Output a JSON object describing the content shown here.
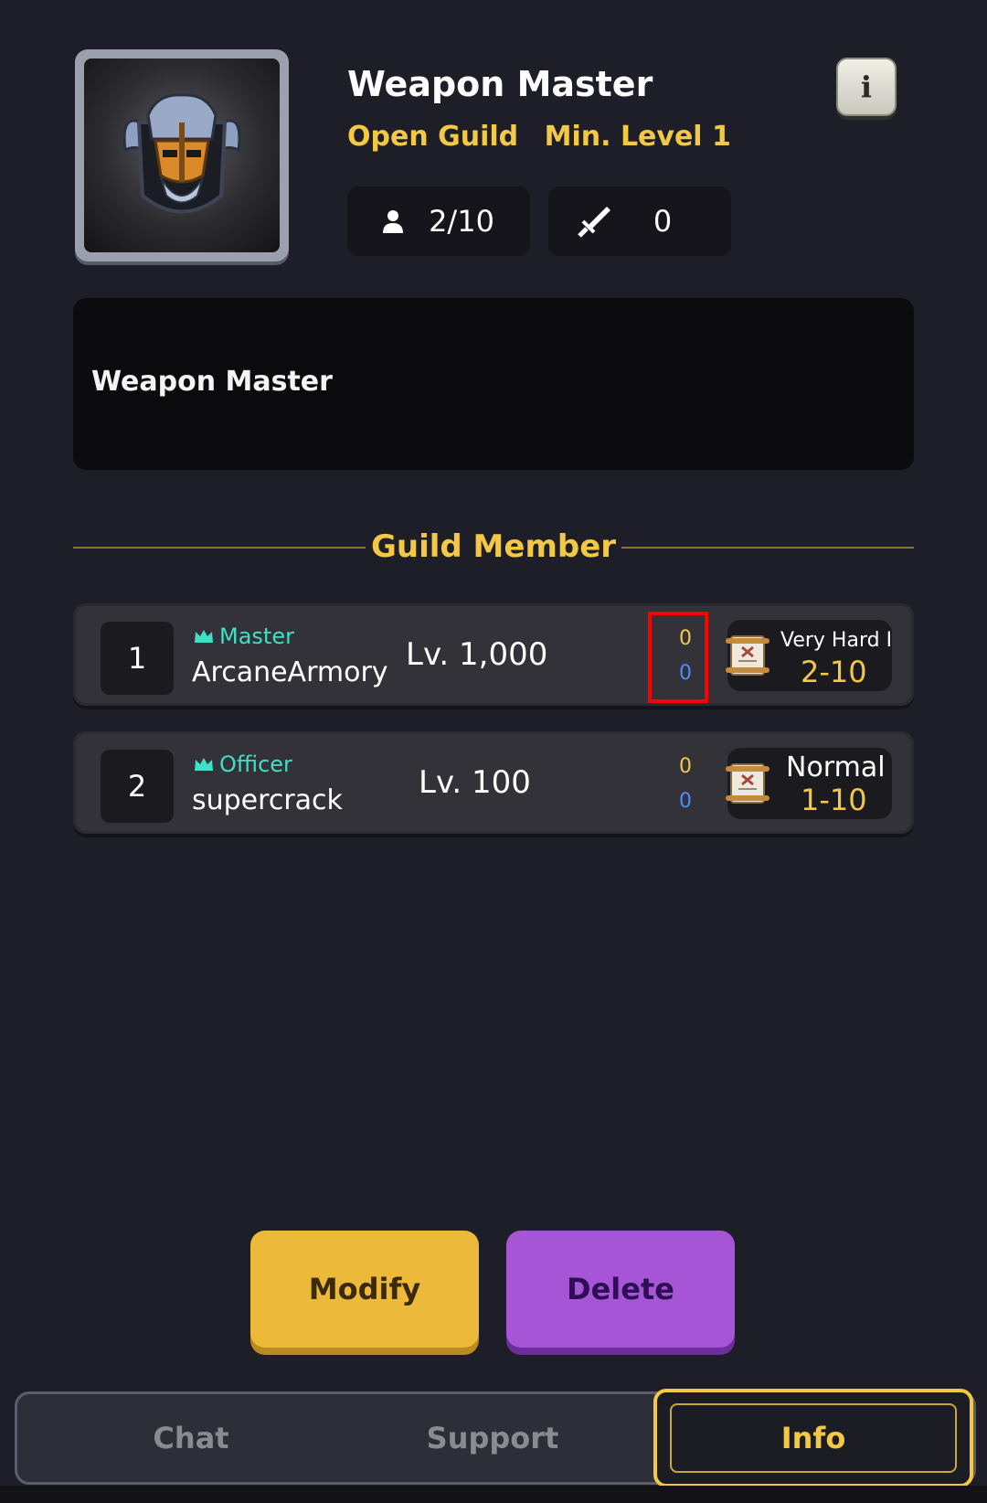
{
  "guild": {
    "name": "Weapon Master",
    "type": "Open Guild",
    "min_level": "Min. Level 1",
    "members_count": "2/10",
    "power": "0",
    "description": "Weapon Master",
    "info_label": "i"
  },
  "section_title": "Guild Member",
  "members": [
    {
      "rank": "1",
      "role": "Master",
      "name": "ArcaneArmory",
      "level": "Lv. 1,000",
      "score_top": "0",
      "score_bottom": "0",
      "difficulty": "Very Hard I",
      "stage": "2-10"
    },
    {
      "rank": "2",
      "role": "Officer",
      "name": "supercrack",
      "level": "Lv. 100",
      "score_top": "0",
      "score_bottom": "0",
      "difficulty": "Normal",
      "stage": "1-10"
    }
  ],
  "buttons": {
    "modify": "Modify",
    "delete": "Delete"
  },
  "tabs": [
    {
      "label": "Chat",
      "active": false
    },
    {
      "label": "Support",
      "active": false
    },
    {
      "label": "Info",
      "active": true
    }
  ],
  "colors": {
    "background": "#1e1e28",
    "accent_gold": "#f2c844",
    "role_teal": "#3fe0c6",
    "score_blue": "#4d8bff",
    "modify_button": "#ecb93b",
    "delete_button": "#a655d6",
    "highlight_red": "#ff0000"
  },
  "icons": {
    "emblem": "helmet-crest-emblem",
    "members": "person-icon",
    "power": "sword-icon",
    "role": "crown-icon",
    "difficulty": "scroll-icon"
  }
}
